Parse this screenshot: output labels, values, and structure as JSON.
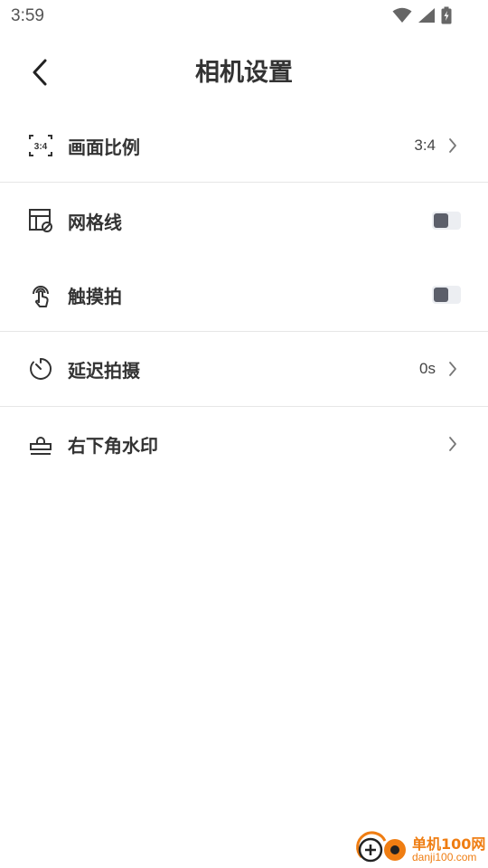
{
  "status_bar": {
    "time": "3:59"
  },
  "header": {
    "title": "相机设置"
  },
  "settings": [
    {
      "label": "画面比例",
      "value": "3:4",
      "icon": "aspect-ratio-icon",
      "ratio_text": "3:4"
    },
    {
      "label": "网格线",
      "toggle": false,
      "icon": "grid-icon"
    },
    {
      "label": "触摸拍",
      "toggle": false,
      "icon": "touch-icon"
    },
    {
      "label": "延迟拍摄",
      "value": "0s",
      "icon": "timer-icon"
    },
    {
      "label": "右下角水印",
      "icon": "stamp-icon"
    }
  ],
  "watermark": {
    "name": "单机100网",
    "url": "danji100.com"
  },
  "colors": {
    "accent": "#ef7d12",
    "toggle_knob": "#5c5f6a",
    "toggle_track": "#eceef2",
    "divider": "#e6e6e6"
  }
}
